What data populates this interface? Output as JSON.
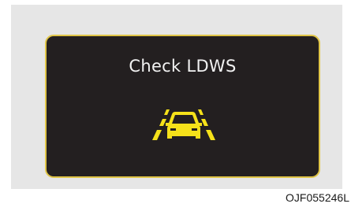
{
  "display": {
    "message": "Check LDWS",
    "icon": "lane-departure-warning-icon",
    "icon_color": "#f5e11a",
    "frame_color": "#e0c547",
    "screen_color": "#231f20"
  },
  "figure_code": "OJF055246L"
}
